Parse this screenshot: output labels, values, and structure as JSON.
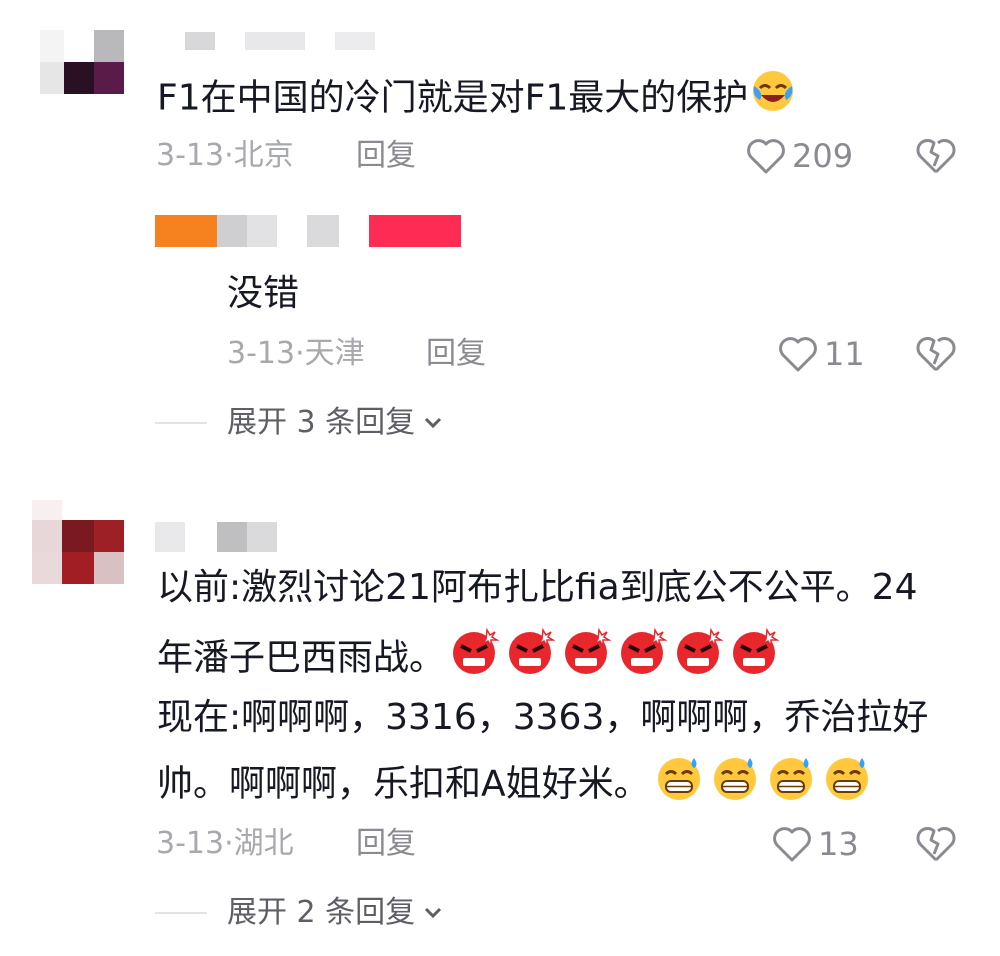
{
  "comments": [
    {
      "text": "F1在中国的冷门就是对F1最大的保护",
      "date": "3-13·",
      "location": "北京",
      "reply_label": "回复",
      "likes": "209",
      "emojis": [
        {
          "icon": "laughing-tears-emoji"
        }
      ],
      "replies": [
        {
          "text": "没错",
          "date": "3-13·",
          "location": "天津",
          "reply_label": "回复",
          "likes": "11"
        }
      ],
      "expand_label": "展开 3 条回复"
    },
    {
      "lines": [
        "以前:激烈讨论21阿布扎比fia到底公不公平。24",
        "年潘子巴西雨战。",
        "现在:啊啊啊，3316，3363，啊啊啊，乔治拉好",
        "帅。啊啊啊，乐扣和A姐好米。"
      ],
      "emojis_line2": {
        "icon": "angry-face-emoji",
        "count": 6
      },
      "emojis_line4": {
        "icon": "grinning-sweat-emoji",
        "count": 4
      },
      "date": "3-13·",
      "location": "湖北",
      "reply_label": "回复",
      "likes": "13",
      "expand_label": "展开 2 条回复"
    }
  ],
  "colors": {
    "text": "#161823",
    "meta": "#a8a9ad",
    "action": "#8a8b91",
    "accent_pink": "#fe2c55",
    "accent_orange": "#f5821f"
  }
}
